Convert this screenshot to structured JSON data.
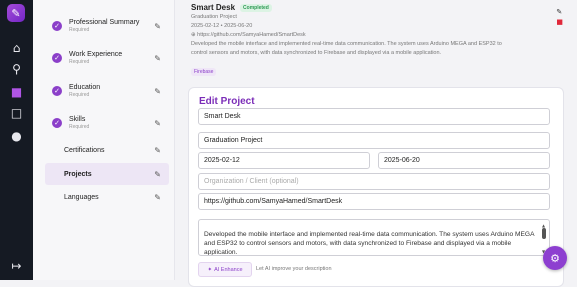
{
  "rail": {
    "logo_icon": "app-logo-icon",
    "icons": [
      "home-icon",
      "search-icon",
      "document-icon",
      "message-icon",
      "user-icon",
      "logout-icon"
    ],
    "accent": "#b055e6"
  },
  "sections": [
    {
      "label": "Professional Summary",
      "sub": "Required",
      "done": true
    },
    {
      "label": "Work Experience",
      "sub": "Required",
      "done": true
    },
    {
      "label": "Education",
      "sub": "Required",
      "done": true
    },
    {
      "label": "Skills",
      "sub": "Required",
      "done": true
    },
    {
      "label": "Certifications",
      "sub": "",
      "done": false
    },
    {
      "label": "Projects",
      "sub": "",
      "done": false,
      "selected": true
    },
    {
      "label": "Languages",
      "sub": "",
      "done": false
    }
  ],
  "project": {
    "title": "Smart Desk",
    "status": "Completed",
    "type": "Graduation Project",
    "dates": "2025-02-12 • 2025-06-20",
    "link": "⊕ https://github.com/SamyaHamed/SmartDesk",
    "desc1": "Developed the mobile interface and implemented real-time data communication. The system uses Arduino MEGA and ESP32 to",
    "desc2": "control sensors and motors, with data synchronized to Firebase and displayed via a mobile application.",
    "tag": "Firebase"
  },
  "edit": {
    "heading": "Edit Project",
    "name": "Smart Desk",
    "type": "Graduation Project",
    "start_date": "2025-02-12",
    "end_date": "2025-06-20",
    "org_placeholder": "Organization / Client (optional)",
    "url": "https://github.com/SamyaHamed/SmartDesk",
    "description": "Developed the mobile interface and implemented real-time data communication. The system uses Arduino MEGA and ESP32 to control sensors and motors, with data synchronized to Firebase and displayed via a mobile application.",
    "ai_button": "AI Enhance",
    "ai_hint": "Let AI improve your description"
  },
  "colors": {
    "brand": "#8b3fc9",
    "completed_bg": "#dcf3e4",
    "completed_fg": "#2f9a55",
    "delete": "#e0283a"
  }
}
